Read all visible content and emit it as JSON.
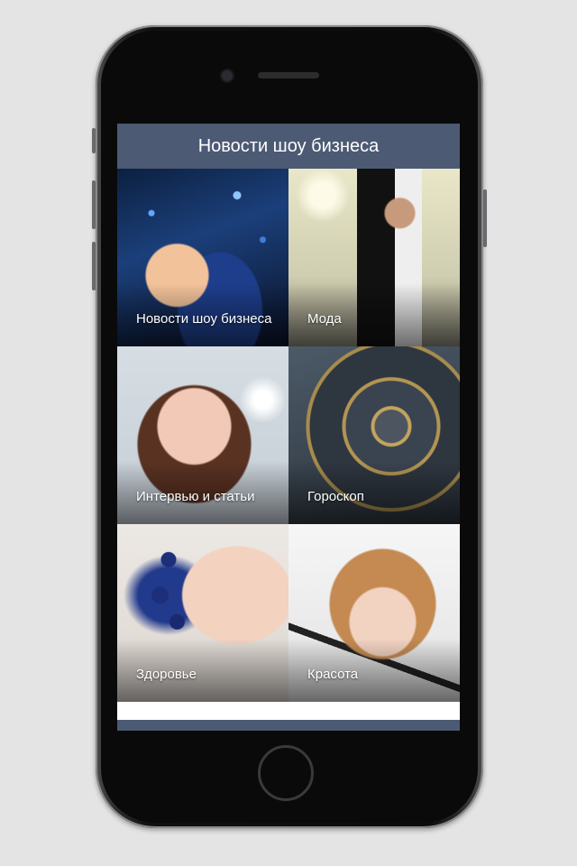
{
  "header": {
    "title": "Новости шоу бизнеса"
  },
  "tiles": [
    {
      "label": "Новости шоу бизнеса",
      "icon": "party-photo"
    },
    {
      "label": "Мода",
      "icon": "fashion-photo"
    },
    {
      "label": "Интервью и статьи",
      "icon": "interview-photo"
    },
    {
      "label": "Гороскоп",
      "icon": "clock-photo"
    },
    {
      "label": "Здоровье",
      "icon": "grapes-photo"
    },
    {
      "label": "Красота",
      "icon": "makeup-photo"
    }
  ],
  "colors": {
    "header_bg": "#4c5a74",
    "header_text": "#ffffff",
    "page_bg": "#e4e4e4"
  }
}
